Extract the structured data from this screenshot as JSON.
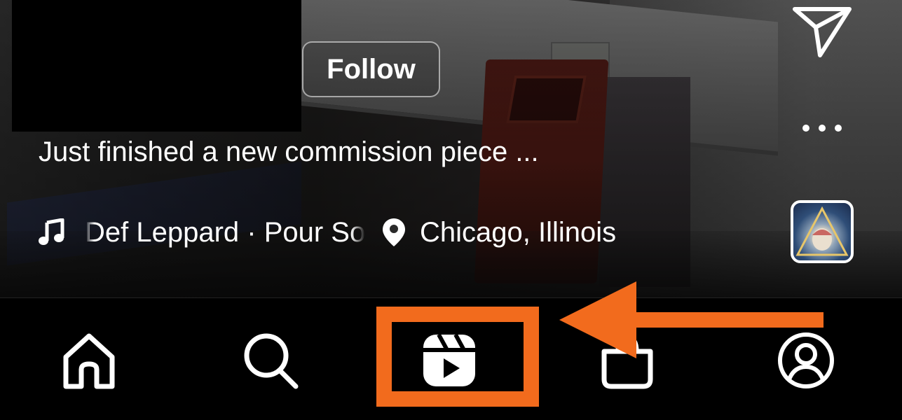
{
  "reel": {
    "follow_label": "Follow",
    "caption": "Just finished a new commission piece ...",
    "music_text": "Def Leppard · Pour Some Sugar On Me",
    "location_text": "Chicago, Illinois"
  },
  "icons": {
    "music": "music-note-icon",
    "location": "location-pin-icon",
    "send": "paper-plane-icon",
    "more": "more-dots-icon",
    "home": "home-icon",
    "search": "search-icon",
    "reels": "reels-icon",
    "shop": "shop-icon",
    "profile": "profile-icon"
  },
  "annotation": {
    "highlight_color": "#f26b1d",
    "arrow_color": "#f26b1d"
  }
}
